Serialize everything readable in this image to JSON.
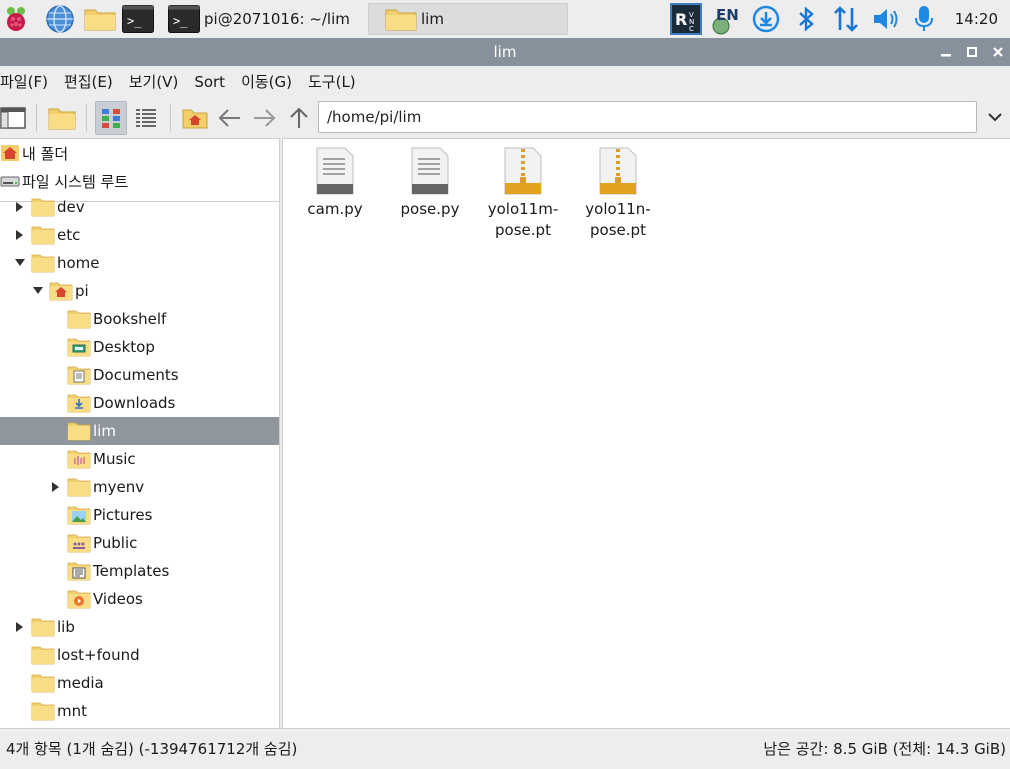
{
  "taskbar": {
    "terminal_task_label": "pi@2071016: ~/lim",
    "folder_task_label": "lim",
    "clock": "14:20",
    "tray_lang": "EN",
    "colors": {
      "bluetooth": "#1976d2",
      "accent": "#1e88e5"
    }
  },
  "window": {
    "title": "lim",
    "buttons": [
      "minimize",
      "maximize",
      "close"
    ]
  },
  "menu": [
    "파일(F)",
    "편집(E)",
    "보기(V)",
    "Sort",
    "이동(G)",
    "도구(L)"
  ],
  "toolbar": {
    "path": "/home/pi/lim"
  },
  "places": [
    {
      "label": "내 폴더",
      "icon": "home-icon"
    },
    {
      "label": "파일 시스템 루트",
      "icon": "drive-icon"
    }
  ],
  "tree": [
    {
      "label": "dev",
      "level": 0,
      "expander": "collapsed",
      "icon": "folder-icon"
    },
    {
      "label": "etc",
      "level": 0,
      "expander": "collapsed",
      "icon": "folder-icon"
    },
    {
      "label": "home",
      "level": 0,
      "expander": "expanded",
      "icon": "folder-icon"
    },
    {
      "label": "pi",
      "level": 1,
      "expander": "expanded",
      "icon": "home-folder-icon"
    },
    {
      "label": "Bookshelf",
      "level": 2,
      "expander": "none",
      "icon": "folder-icon"
    },
    {
      "label": "Desktop",
      "level": 2,
      "expander": "none",
      "icon": "desktop-folder-icon"
    },
    {
      "label": "Documents",
      "level": 2,
      "expander": "none",
      "icon": "documents-folder-icon"
    },
    {
      "label": "Downloads",
      "level": 2,
      "expander": "none",
      "icon": "downloads-folder-icon"
    },
    {
      "label": "lim",
      "level": 2,
      "expander": "none",
      "icon": "folder-icon",
      "selected": true
    },
    {
      "label": "Music",
      "level": 2,
      "expander": "none",
      "icon": "music-folder-icon"
    },
    {
      "label": "myenv",
      "level": 2,
      "expander": "collapsed",
      "icon": "folder-icon"
    },
    {
      "label": "Pictures",
      "level": 2,
      "expander": "none",
      "icon": "pictures-folder-icon"
    },
    {
      "label": "Public",
      "level": 2,
      "expander": "none",
      "icon": "public-folder-icon"
    },
    {
      "label": "Templates",
      "level": 2,
      "expander": "none",
      "icon": "templates-folder-icon"
    },
    {
      "label": "Videos",
      "level": 2,
      "expander": "none",
      "icon": "videos-folder-icon"
    },
    {
      "label": "lib",
      "level": 0,
      "expander": "collapsed",
      "icon": "folder-icon"
    },
    {
      "label": "lost+found",
      "level": 0,
      "expander": "none",
      "icon": "folder-icon"
    },
    {
      "label": "media",
      "level": 0,
      "expander": "none",
      "icon": "folder-icon"
    },
    {
      "label": "mnt",
      "level": 0,
      "expander": "none",
      "icon": "folder-icon"
    }
  ],
  "files": [
    {
      "name": "cam.py",
      "type": "text"
    },
    {
      "name": "pose.py",
      "type": "text"
    },
    {
      "name": "yolo11m-pose.pt",
      "type": "archive"
    },
    {
      "name": "yolo11n-pose.pt",
      "type": "archive"
    }
  ],
  "status": {
    "left": "4개 항목 (1개 숨김) (-1394761712개 숨김)",
    "right": "남은 공간: 8.5 GiB (전체: 14.3 GiB)"
  }
}
